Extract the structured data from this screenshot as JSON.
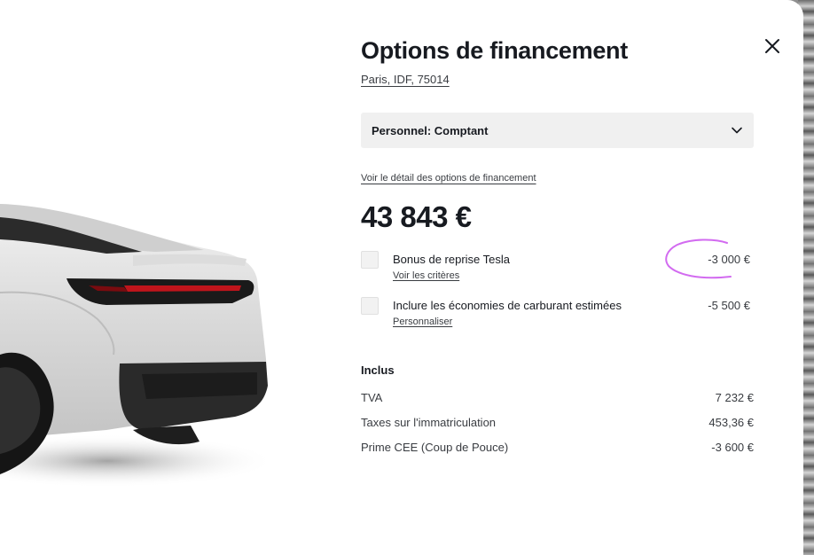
{
  "header": {
    "title": "Options de financement",
    "location": "Paris, IDF, 75014"
  },
  "financing_select": {
    "value": "Personnel: Comptant"
  },
  "details_link": "Voir le détail des options de financement",
  "price": "43 843 €",
  "options": [
    {
      "label": "Bonus de reprise Tesla",
      "link": "Voir les critères",
      "amount": "-3 000 €",
      "checked": false
    },
    {
      "label": "Inclure les économies de carburant estimées",
      "link": "Personnaliser",
      "amount": "-5 500 €",
      "checked": false
    }
  ],
  "included": {
    "title": "Inclus",
    "rows": [
      {
        "label": "TVA",
        "value": "7 232 €"
      },
      {
        "label": "Taxes sur l'immatriculation",
        "value": "453,36 €"
      },
      {
        "label": "Prime CEE (Coup de Pouce)",
        "value": "-3 600 €"
      }
    ]
  },
  "icons": {
    "close": "close-icon",
    "dropdown": "chevron-down-icon"
  },
  "colors": {
    "text": "#171a20",
    "secondary_text": "#393c41",
    "select_bg": "#f0f0f0",
    "annotation": "#d26bf0"
  }
}
